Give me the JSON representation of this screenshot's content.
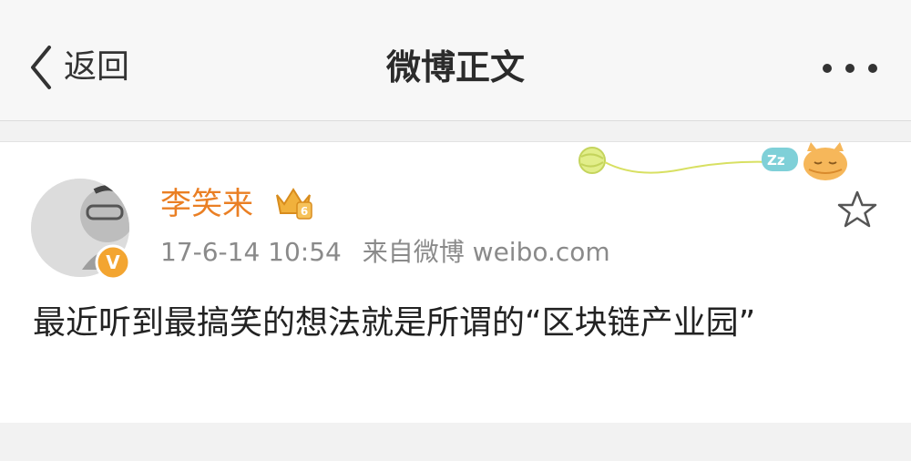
{
  "navbar": {
    "back_label": "返回",
    "title": "微博正文",
    "more_icon": "more-dots-icon"
  },
  "post": {
    "username": "李笑来",
    "timestamp": "17-6-14 10:54",
    "source": "来自微博 weibo.com",
    "text": "最近听到最搞笑的想法就是所谓的“区块链产业园”",
    "crown_level": "6",
    "verified_badge_letter": "V",
    "decor_zzz_label": "Zz"
  },
  "colors": {
    "username": "#ea7f24",
    "verified_badge": "#f3a531",
    "background": "#f2f2f2"
  }
}
